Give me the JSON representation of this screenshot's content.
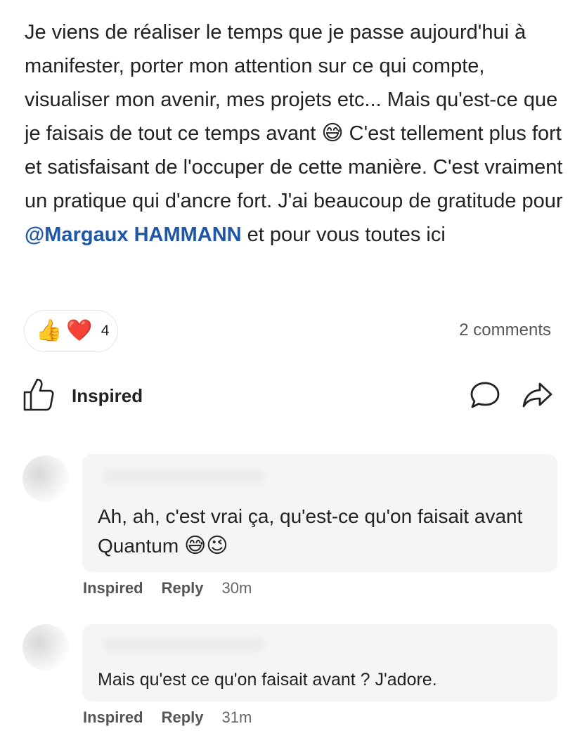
{
  "post": {
    "text_part1": "Je viens de réaliser le temps que je passe aujourd'hui à manifester, porter mon attention sur ce qui compte, visualiser mon avenir, mes projets etc... Mais qu'est-ce que je faisais de tout ce temps avant ",
    "emoji_sweat": "😅",
    "text_part2": " C'est tellement plus fort et satisfaisant de l'occuper de cette manière. C'est vraiment un pratique qui d'ancre fort. J'ai beaucoup de gratitude pour ",
    "mention": "@Margaux HAMMANN",
    "text_part3": " et pour vous toutes ici"
  },
  "reactions": {
    "emoji_thumbs": "👍",
    "emoji_heart": "❤️",
    "count": "4"
  },
  "comments_count_label": "2 comments",
  "actions": {
    "like_label": "Inspired",
    "like_icon": "thumbs-up-icon",
    "comment_icon": "comment-bubble-icon",
    "share_icon": "share-arrow-icon"
  },
  "comments": [
    {
      "text": "Ah, ah, c'est vrai ça, qu'est-ce qu'on faisait avant Quantum ",
      "emoji1": "😅",
      "emoji2": "😉",
      "inspired_label": "Inspired",
      "reply_label": "Reply",
      "time": "30m"
    },
    {
      "text": "Mais qu'est ce qu'on faisait avant ? J'adore.",
      "inspired_label": "Inspired",
      "reply_label": "Reply",
      "time": "31m"
    }
  ]
}
